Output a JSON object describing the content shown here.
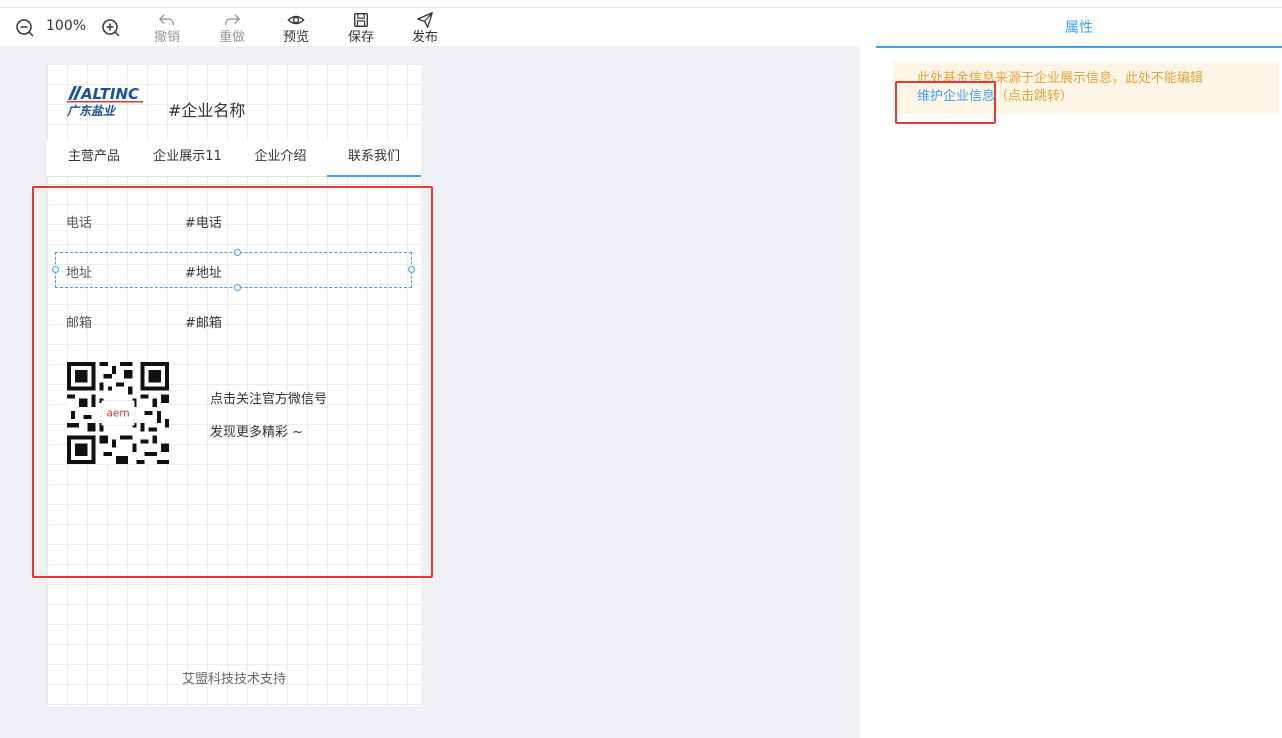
{
  "toolbar": {
    "zoom_level": "100%",
    "undo_label": "撤销",
    "redo_label": "重做",
    "preview_label": "预览",
    "save_label": "保存",
    "publish_label": "发布"
  },
  "header": {
    "logo_text_en": "ALTINC",
    "logo_text_cn": "广东盐业",
    "company_name": "#企业名称"
  },
  "tabs": [
    {
      "label": "主营产品"
    },
    {
      "label": "企业展示11"
    },
    {
      "label": "企业介绍"
    },
    {
      "label": "联系我们"
    }
  ],
  "contact": {
    "phone_label": "电话",
    "phone_value": "#电话",
    "address_label": "地址",
    "address_value": "#地址",
    "email_label": "邮箱",
    "email_value": "#邮箱",
    "qr_line1": "点击关注官方微信号",
    "qr_line2": "发现更多精彩 ~"
  },
  "footer": {
    "text": "艾盟科技技术支持"
  },
  "panel": {
    "tab_label": "属性",
    "notice_text": "此处基金信息来源于企业展示信息，此处不能编辑",
    "link_label": "维护企业信息",
    "link_hint": "（点击跳转）"
  },
  "colors": {
    "accent": "#409eff",
    "warning": "#e6a23c",
    "highlight": "#e53935"
  }
}
